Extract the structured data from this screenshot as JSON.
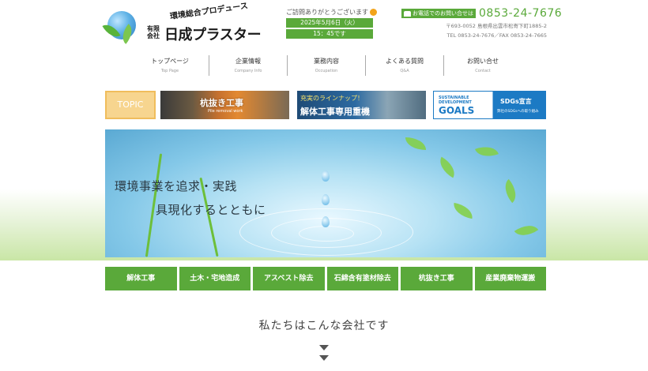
{
  "header": {
    "logo": {
      "subtitle": "環境総合プロデュース",
      "company_type": "有限会社",
      "company_name": "日成プラスター"
    },
    "visit": {
      "message": "ご訪問ありがとうございます",
      "date": "2025年5月6日（火）",
      "time": "15：45です"
    },
    "contact": {
      "tel_label": "お電話でのお問い合せは",
      "tel": "0853-24-7676",
      "address": "〒693-0052 島根県出雲市松寄下町1885-2",
      "telfax": "TEL 0853-24-7676／FAX 0853-24-7665"
    }
  },
  "nav": [
    {
      "jp": "トップページ",
      "en": "Top Page"
    },
    {
      "jp": "企業情報",
      "en": "Company Info"
    },
    {
      "jp": "業務内容",
      "en": "Occupation"
    },
    {
      "jp": "よくある質問",
      "en": "Q&A"
    },
    {
      "jp": "お問い合せ",
      "en": "Contact"
    }
  ],
  "topic": {
    "label": "TOPIC",
    "banner1": {
      "title": "杭抜き工事",
      "sub": "Pile removal work"
    },
    "banner2": {
      "line1": "充実のラインナップ！",
      "line2": "解体工事専用重機"
    },
    "banner3": {
      "line1": "SUSTAINABLE DEVELOPMENT",
      "goals": "GOALS",
      "right1": "SDGs宣言",
      "right2": "弊社のSDGsへの取り組み"
    }
  },
  "hero": {
    "line1": "環境事業を追求・実践",
    "line2": "具現化するとともに"
  },
  "services": [
    "解体工事",
    "土木・宅地造成",
    "アスベスト除去",
    "石綿含有塗材除去",
    "杭抜き工事",
    "産業廃棄物運搬"
  ],
  "about": {
    "title": "私たちはこんな会社です"
  },
  "colors": {
    "brand_green": "#5aa93a",
    "topic_orange": "#f7d58f",
    "sdgs_blue": "#1c7ac4"
  }
}
